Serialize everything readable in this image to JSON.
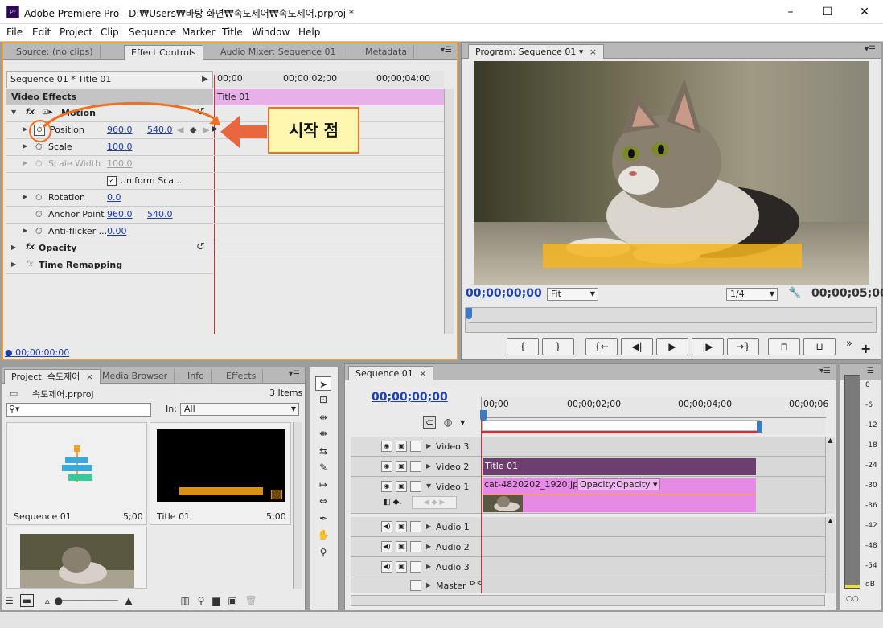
{
  "window": {
    "title": "Adobe Premiere Pro - D:₩Users₩바탕 화면₩속도제어₩속도제어.prproj *",
    "app_icon": "Pr",
    "controls": [
      "–",
      "☐",
      "✕"
    ]
  },
  "menu": [
    "File",
    "Edit",
    "Project",
    "Clip",
    "Sequence",
    "Marker",
    "Title",
    "Window",
    "Help"
  ],
  "source_panel": {
    "tabs": [
      "Source: (no clips)",
      "Effect Controls",
      "Audio Mixer: Sequence 01",
      "Metadata"
    ],
    "sequence_label": "Sequence 01 * Title 01",
    "video_effects": "Video Effects",
    "motion": "Motion",
    "params": {
      "position": {
        "label": "Position",
        "x": "960.0",
        "y": "540.0"
      },
      "scale": {
        "label": "Scale",
        "value": "100.0"
      },
      "scale_width": {
        "label": "Scale Width",
        "value": "100.0"
      },
      "uniform": "Uniform Sca...",
      "rotation": {
        "label": "Rotation",
        "value": "0.0"
      },
      "anchor": {
        "label": "Anchor Point",
        "x": "960.0",
        "y": "540.0"
      },
      "antiflicker": {
        "label": "Anti-flicker ...",
        "value": "0.00"
      }
    },
    "opacity": "Opacity",
    "time_remap": "Time Remapping",
    "timecode": "00;00:00:00",
    "ruler": [
      "00;00",
      "00;00;02;00",
      "00;00;04;00"
    ],
    "clip_label": "Title 01",
    "callout": "시작 점"
  },
  "program": {
    "tab": "Program: Sequence 01",
    "timecode_left": "00;00;00;00",
    "fit": "Fit",
    "res": "1/4",
    "timecode_right": "00;00;05;00",
    "buttons": [
      "{",
      "}",
      "{←",
      "◀|",
      "▶",
      "|▶",
      "→}",
      "⊓",
      "⊔"
    ]
  },
  "project": {
    "tabs": [
      "Project: 속도제어",
      "Media Browser",
      "Info",
      "Effects"
    ],
    "file": "속도제어.prproj",
    "count": "3 Items",
    "in_label": "In:",
    "in_value": "All",
    "items": [
      {
        "name": "Sequence 01",
        "duration": "5;00"
      },
      {
        "name": "Title 01",
        "duration": "5;00"
      }
    ]
  },
  "sequence": {
    "tab": "Sequence 01",
    "timecode": "00;00;00;00",
    "ruler": [
      "00;00",
      "00;00;02;00",
      "00;00;04;00",
      "00;00;06"
    ],
    "tracks": [
      "Video 3",
      "Video 2",
      "Video 1",
      "Audio 1",
      "Audio 2",
      "Audio 3",
      "Master"
    ],
    "clip_title": "Title 01",
    "clip_image": "cat-4820202_1920.jpg",
    "clip_opacity": "Opacity:Opacity"
  },
  "meter": [
    "0",
    "-6",
    "-12",
    "-18",
    "-24",
    "-30",
    "-36",
    "-42",
    "-48",
    "-54",
    "dB"
  ]
}
